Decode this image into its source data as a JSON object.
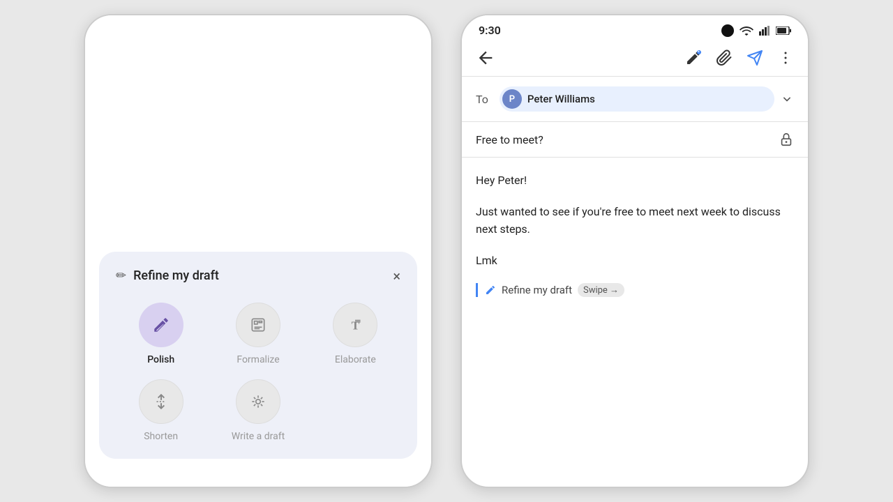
{
  "leftPhone": {
    "panel": {
      "title": "Refine my draft",
      "closeLabel": "×",
      "items": [
        {
          "id": "polish",
          "label": "Polish",
          "icon": "✏",
          "active": true
        },
        {
          "id": "formalize",
          "label": "Formalize",
          "icon": "🗂",
          "active": false
        },
        {
          "id": "elaborate",
          "label": "Elaborate",
          "icon": "T",
          "active": false
        },
        {
          "id": "shorten",
          "label": "Shorten",
          "icon": "⇅",
          "active": false
        },
        {
          "id": "write-draft",
          "label": "Write a draft",
          "icon": "✦",
          "active": false
        }
      ]
    }
  },
  "rightPhone": {
    "statusBar": {
      "time": "9:30"
    },
    "email": {
      "toLabel": "To",
      "recipient": {
        "initial": "P",
        "name": "Peter Williams"
      },
      "subject": "Free to meet?",
      "body": {
        "greeting": "Hey Peter!",
        "paragraph": "Just wanted to see if you're free to meet next week to discuss next steps.",
        "sign": "Lmk"
      },
      "refineInline": "Refine my draft",
      "swipe": "Swipe →"
    },
    "toolbar": {
      "back": "←",
      "penIcon": "✎",
      "clipIcon": "⊘",
      "sendIcon": "▷",
      "moreIcon": "⋮"
    }
  }
}
